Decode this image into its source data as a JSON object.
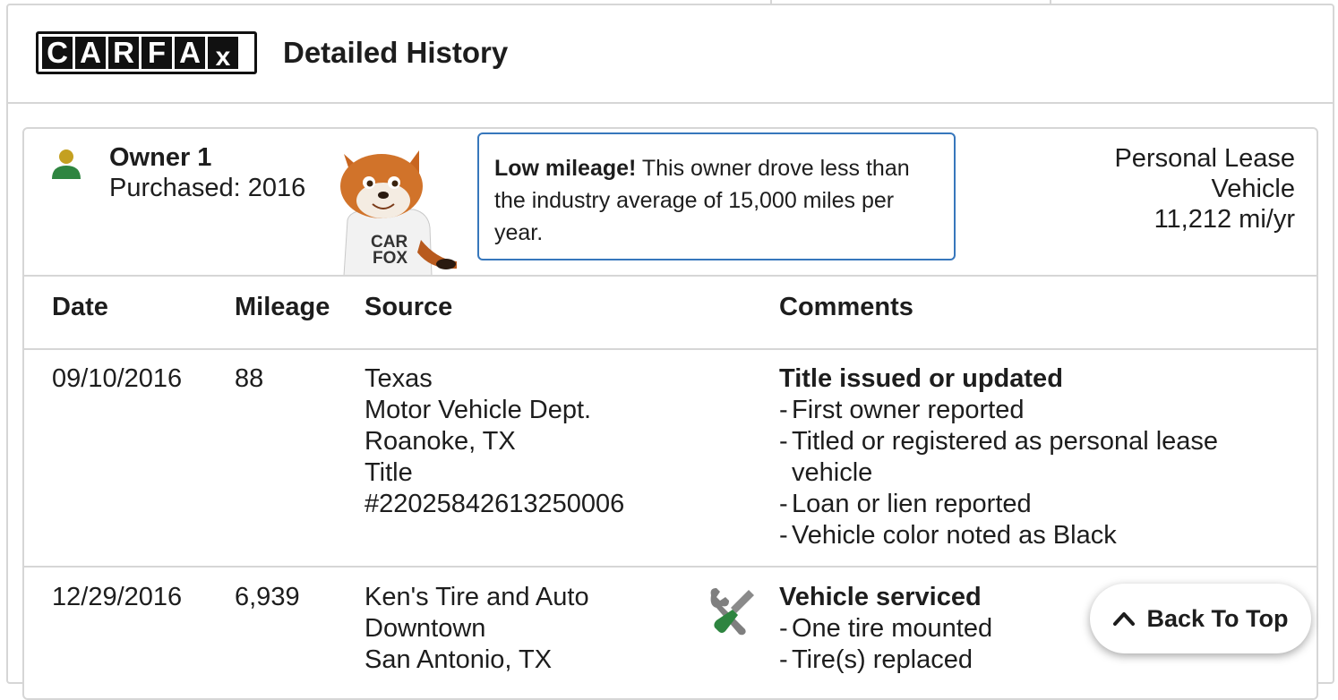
{
  "header": {
    "logo_letters": [
      "C",
      "A",
      "R",
      "F",
      "A",
      "x"
    ],
    "title": "Detailed History"
  },
  "owner": {
    "title": "Owner 1",
    "purchased": "Purchased: 2016",
    "icon": "person-icon",
    "icon_colors": {
      "head": "#c4a021",
      "body": "#2e8540"
    }
  },
  "mascot": {
    "name": "carfox-mascot",
    "shirt_text": [
      "CAR",
      "FOX"
    ]
  },
  "callout": {
    "bold": "Low mileage!",
    "text": " This owner drove less than the industry average of 15,000 miles per year.",
    "border_color": "#3777bc"
  },
  "lease": {
    "line1": "Personal Lease",
    "line2": "Vehicle",
    "line3": "11,212 mi/yr"
  },
  "table": {
    "headers": {
      "date": "Date",
      "mileage": "Mileage",
      "source": "Source",
      "comments": "Comments"
    },
    "rows": [
      {
        "date": "09/10/2016",
        "mileage": "88",
        "source": [
          "Texas",
          "Motor Vehicle Dept.",
          "Roanoke, TX",
          "Title",
          "#22025842613250006"
        ],
        "comment_title": "Title issued or updated",
        "comments": [
          "First owner reported",
          "Titled or registered as personal lease vehicle",
          "Loan or lien reported",
          "Vehicle color noted as Black"
        ]
      },
      {
        "date": "12/29/2016",
        "mileage": "6,939",
        "source": [
          "Ken's Tire and Auto",
          "Downtown",
          "San Antonio, TX"
        ],
        "icon": "service-tools-icon",
        "comment_title": "Vehicle serviced",
        "comments": [
          "One tire mounted",
          "Tire(s) replaced"
        ]
      }
    ]
  },
  "back_to_top": {
    "label": "Back To Top",
    "icon": "chevron-up-icon"
  }
}
